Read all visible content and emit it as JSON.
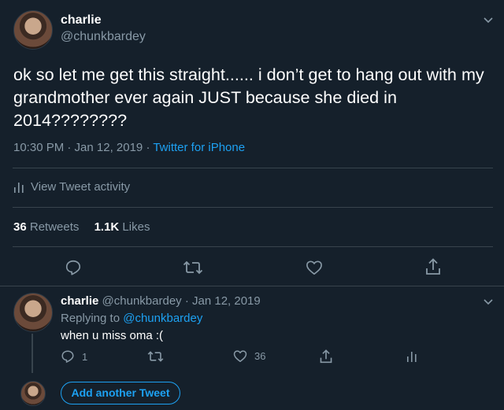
{
  "colors": {
    "background": "#15202b",
    "muted": "#8899a6",
    "accent": "#1da1f2",
    "divider": "#38444d"
  },
  "main_tweet": {
    "display_name": "charlie",
    "handle": "@chunkbardey",
    "text": "ok so let me get this straight...... i don’t get to hang out with my grandmother ever again JUST because she died in 2014????????",
    "time": "10:30 PM · Jan 12, 2019 · ",
    "source": "Twitter for iPhone",
    "activity_label": "View Tweet activity",
    "retweets_count": "36",
    "retweets_label": "Retweets",
    "likes_count": "1.1K",
    "likes_label": "Likes",
    "icons": [
      "chevron-down-icon",
      "reply-icon",
      "retweet-icon",
      "like-icon",
      "share-icon",
      "activity-icon"
    ]
  },
  "reply_tweet": {
    "display_name": "charlie",
    "meta": "@chunkbardey · Jan 12, 2019",
    "replying_prefix": "Replying to ",
    "replying_handle": "@chunkbardey",
    "text": "when u miss oma :(",
    "reply_count": "1",
    "like_count": "36"
  },
  "composer": {
    "add_tweet_label": "Add another Tweet"
  }
}
